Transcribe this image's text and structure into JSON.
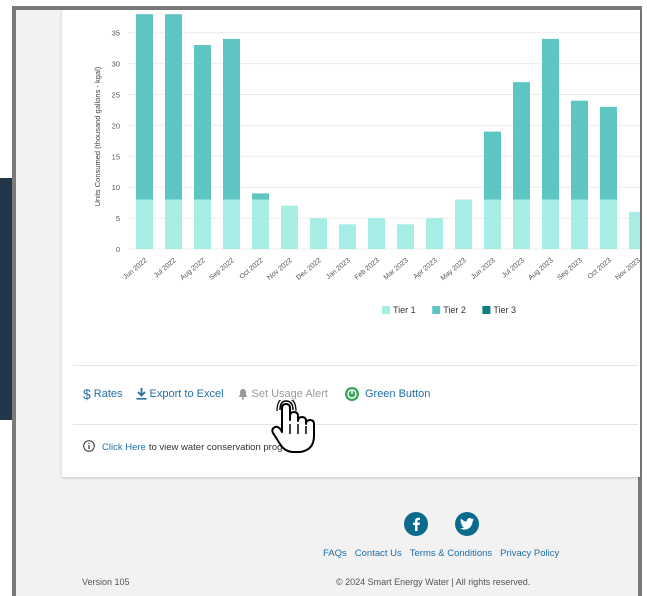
{
  "chart_data": {
    "type": "bar",
    "ylabel": "Units Consumed (thousand gallons - kgal)",
    "ylim": [
      0,
      38
    ],
    "yticks": [
      0,
      5,
      10,
      15,
      20,
      25,
      30,
      35
    ],
    "categories": [
      "Jun 2022",
      "Jul 2022",
      "Aug 2022",
      "Sep 2022",
      "Oct 2022",
      "Nov 2022",
      "Dec 2022",
      "Jan 2023",
      "Feb 2023",
      "Mar 2023",
      "Apr 2023",
      "May 2023",
      "Jun 2023",
      "Jul 2023",
      "Aug 2023",
      "Sep 2023",
      "Oct 2023",
      "Nov 2023"
    ],
    "series": [
      {
        "name": "Tier 1",
        "color": "#a8ece6",
        "values": [
          8,
          8,
          8,
          8,
          8,
          7,
          5,
          4,
          5,
          4,
          5,
          8,
          8,
          8,
          8,
          8,
          8,
          6
        ]
      },
      {
        "name": "Tier 2",
        "color": "#5ec6c2",
        "values": [
          30,
          30,
          25,
          26,
          1,
          0,
          0,
          0,
          0,
          0,
          0,
          0,
          11,
          19,
          26,
          16,
          15,
          0
        ]
      },
      {
        "name": "Tier 3",
        "color": "#0e7f7f",
        "values": [
          0,
          0,
          0,
          0,
          0,
          0,
          0,
          0,
          0,
          0,
          0,
          0,
          0,
          0,
          0,
          0,
          0,
          0
        ]
      }
    ],
    "legend_position": "bottom-center",
    "grid": true
  },
  "toolbar": {
    "rates_label": "Rates",
    "rates_symbol": "$",
    "export_label": "Export to Excel",
    "alert_label": "Set Usage Alert",
    "green_label": "Green Button"
  },
  "info": {
    "link_text": "Click Here",
    "text": "to view water conservation prog"
  },
  "footer": {
    "links": [
      "FAQs",
      "Contact Us",
      "Terms & Conditions",
      "Privacy Policy"
    ],
    "version": "Version  105",
    "copyright": "© 2024 Smart Energy Water | All rights reserved."
  },
  "icons": {
    "facebook": "facebook-icon",
    "twitter": "twitter-icon"
  }
}
